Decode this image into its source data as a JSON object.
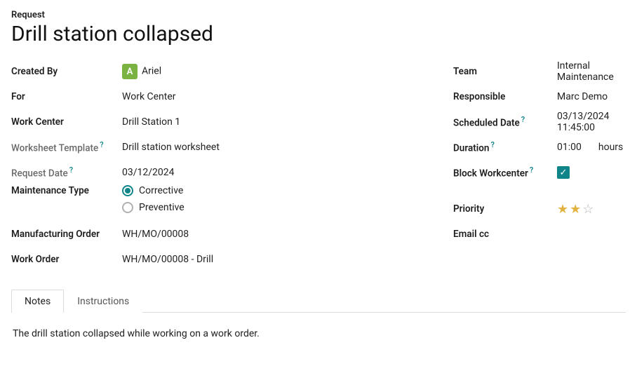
{
  "header": {
    "request_label": "Request",
    "title": "Drill station collapsed"
  },
  "left": {
    "created_by": {
      "label": "Created By",
      "avatar_letter": "A",
      "name": "Ariel"
    },
    "for": {
      "label": "For",
      "value": "Work Center"
    },
    "work_center": {
      "label": "Work Center",
      "value": "Drill Station 1"
    },
    "worksheet_template": {
      "label": "Worksheet Template",
      "value": "Drill station worksheet"
    },
    "request_date": {
      "label": "Request Date",
      "value": "03/12/2024"
    },
    "maintenance_type": {
      "label": "Maintenance Type",
      "options": {
        "corrective": "Corrective",
        "preventive": "Preventive"
      },
      "selected": "corrective"
    },
    "manufacturing_order": {
      "label": "Manufacturing Order",
      "value": "WH/MO/00008"
    },
    "work_order": {
      "label": "Work Order",
      "value": "WH/MO/00008 - Drill"
    }
  },
  "right": {
    "team": {
      "label": "Team",
      "value": "Internal Maintenance"
    },
    "responsible": {
      "label": "Responsible",
      "value": "Marc Demo"
    },
    "scheduled_date": {
      "label": "Scheduled Date",
      "value": "03/13/2024 11:45:00"
    },
    "duration": {
      "label": "Duration",
      "value": "01:00",
      "unit": "hours"
    },
    "block_workcenter": {
      "label": "Block Workcenter",
      "checked": true
    },
    "priority": {
      "label": "Priority",
      "stars": 2,
      "max_stars": 3
    },
    "email_cc": {
      "label": "Email cc",
      "value": ""
    }
  },
  "tabs": {
    "notes": "Notes",
    "instructions": "Instructions",
    "active": "notes"
  },
  "notes_content": "The drill station collapsed while working on a work order."
}
